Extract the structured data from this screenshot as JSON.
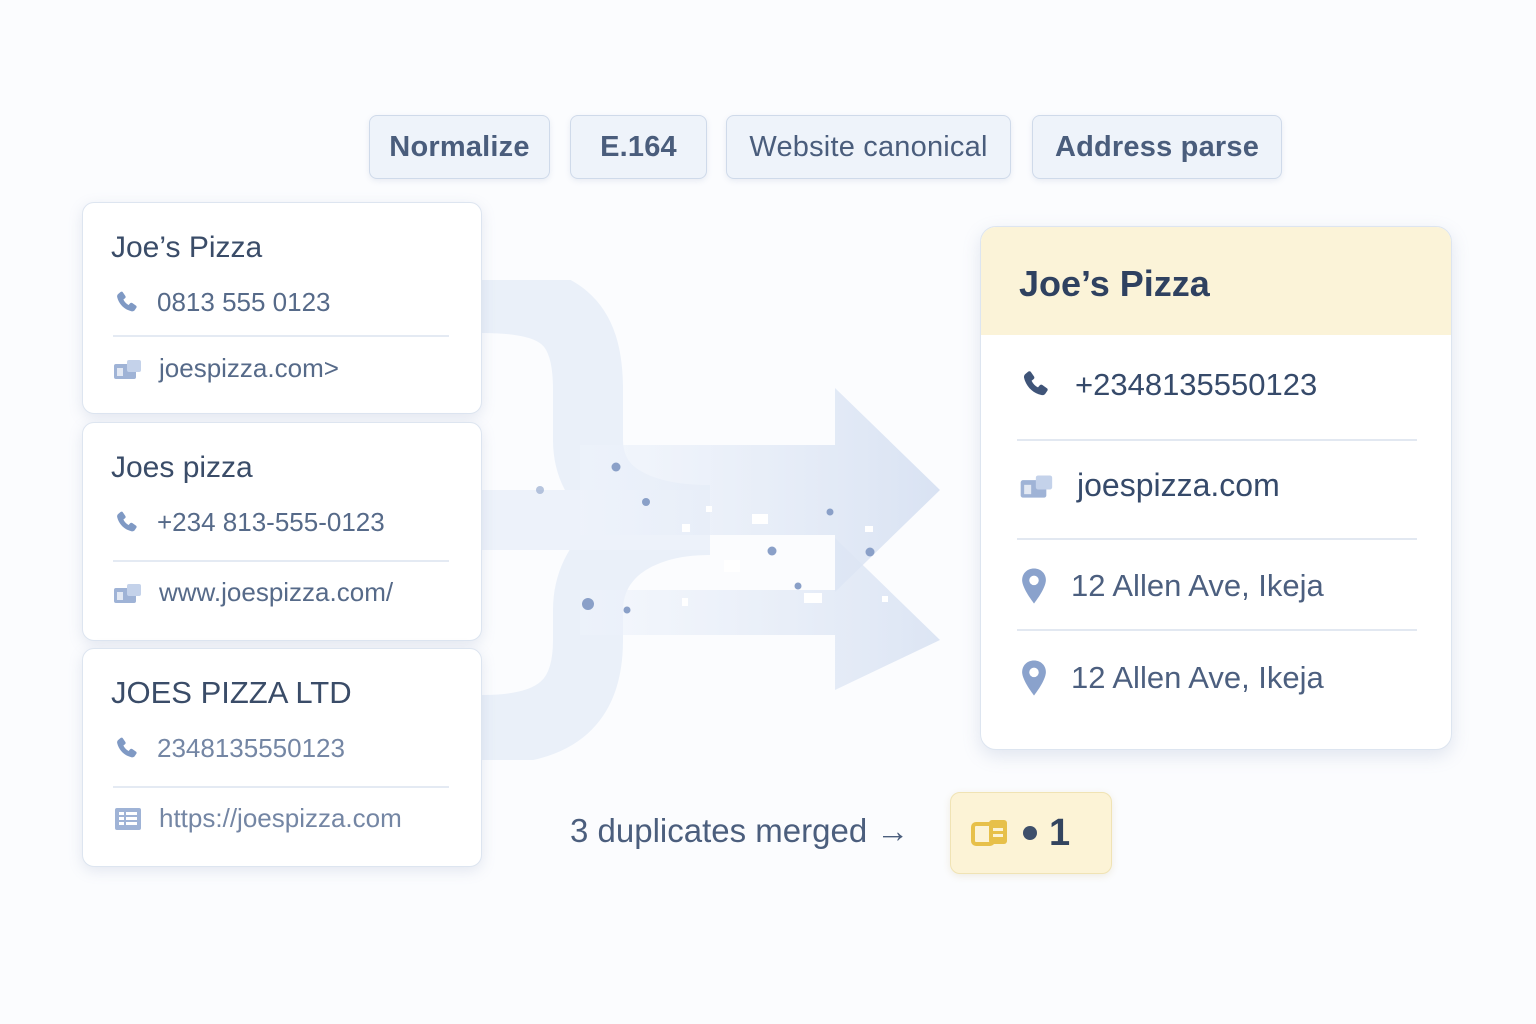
{
  "steps": [
    {
      "label": "Normalize"
    },
    {
      "label": "E.164"
    },
    {
      "label": "Website canonical"
    },
    {
      "label": "Address parse"
    }
  ],
  "sources": [
    {
      "name": "Joe’s Pizza",
      "phone": "0813 555 0123",
      "website": "joespizza.com>"
    },
    {
      "name": "Joes pizza",
      "phone": "+234 813-555-0123",
      "website": "www.joespizza.com/"
    },
    {
      "name": "JOES PIZZA LTD",
      "phone": "2348135550123",
      "website": "https://joespizza.com"
    }
  ],
  "result": {
    "name": "Joe’s Pizza",
    "phone": "+2348135550123",
    "website": "joespizza.com",
    "address_1": "12 Allen Ave, Ikeja",
    "address_2": "12 Allen Ave, Ikeja"
  },
  "summary": {
    "text": "3 duplicates merged →",
    "badge_count": "1"
  },
  "icons": {
    "phone": "phone-icon",
    "website": "website-icon",
    "location": "location-pin-icon",
    "merged": "merged-record-icon"
  },
  "colors": {
    "accent_yellow": "#fbf3d8",
    "icon_blue": "#8aa2cc",
    "text_dark": "#2f4160"
  }
}
